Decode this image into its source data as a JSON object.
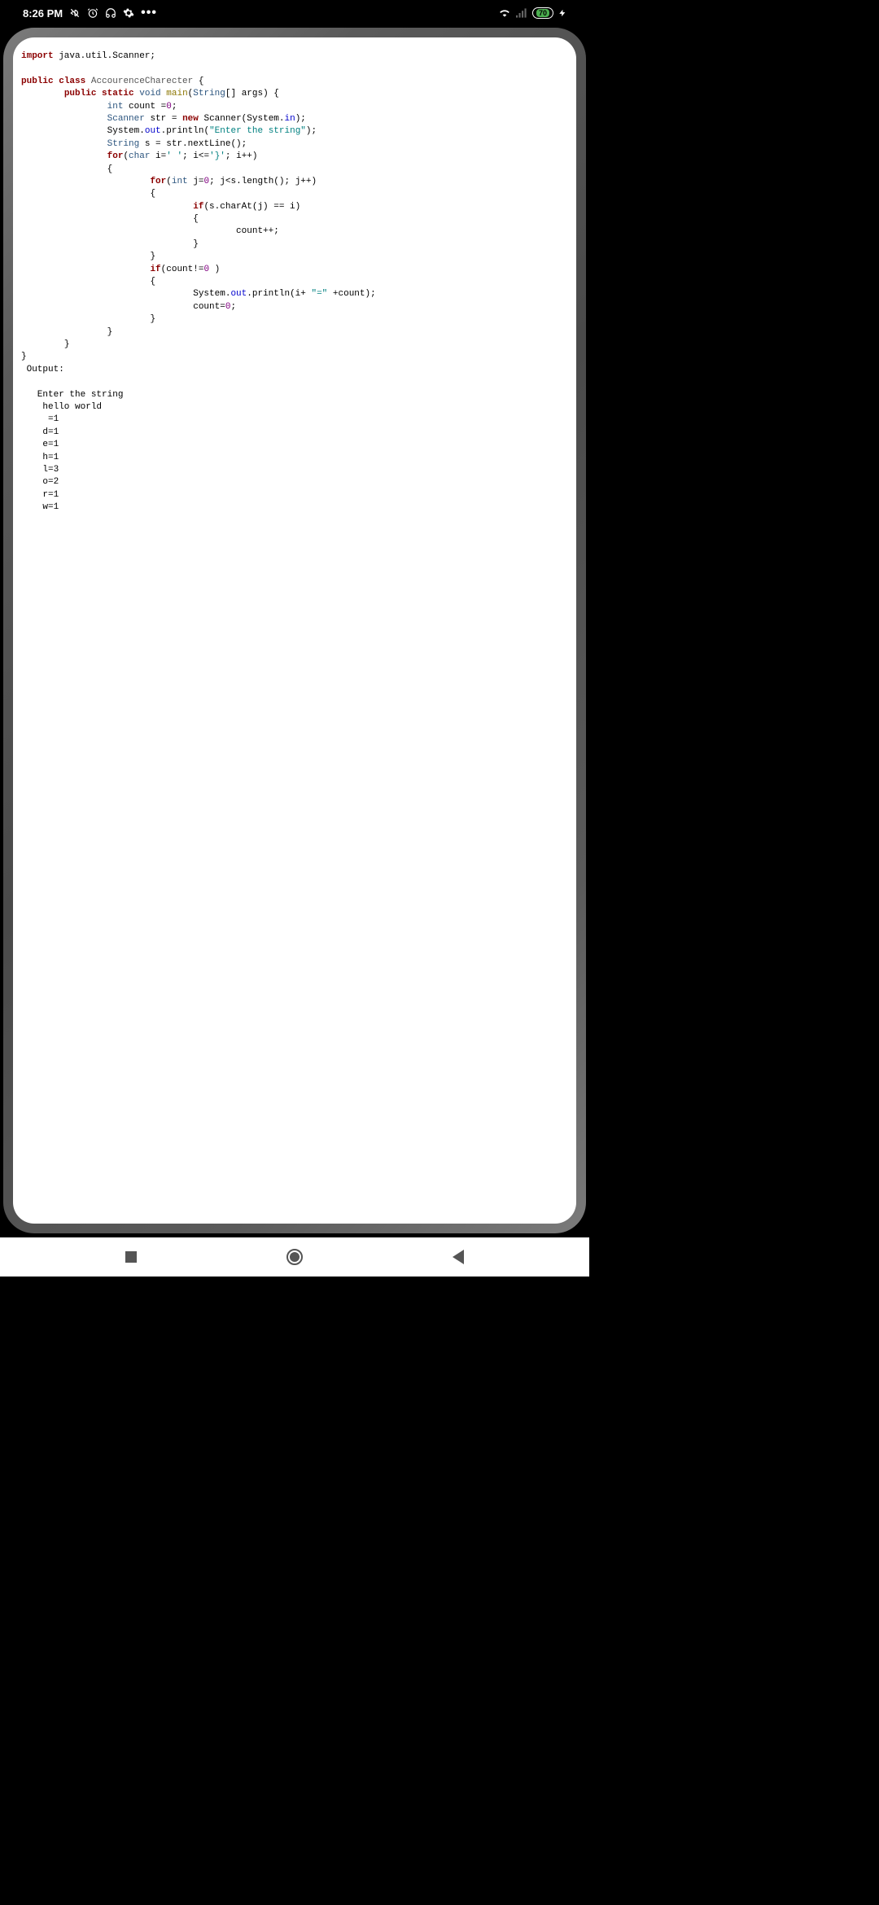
{
  "status": {
    "time": "8:26 PM",
    "battery": "70"
  },
  "code": {
    "line1_kw1": "import",
    "line1_rest": " java.util.Scanner;",
    "line3_kw1": "public",
    "line3_kw2": "class",
    "line3_cls": "AccourenceCharecter",
    "line3_brace": " {",
    "line4_indent": "        ",
    "line4_kw1": "public",
    "line4_kw2": "static",
    "line4_type": "void",
    "line4_method": "main",
    "line4_paren": "(",
    "line4_argtype": "String",
    "line4_args": "[] args) {",
    "line5_indent": "                ",
    "line5_type": "int",
    "line5_rest": " count =",
    "line5_num": "0",
    "line5_semi": ";",
    "line6_indent": "                ",
    "line6_type": "Scanner",
    "line6_var": " str = ",
    "line6_kw": "new",
    "line6_rest": " Scanner(System.",
    "line6_field": "in",
    "line6_end": ");",
    "line7_indent": "                ",
    "line7_sys": "System.",
    "line7_out": "out",
    "line7_print": ".println(",
    "line7_str": "\"Enter the string\"",
    "line7_end": ");",
    "line8_indent": "                ",
    "line8_type": "String",
    "line8_rest": " s = str.nextLine();",
    "line9_indent": "                ",
    "line9_kw": "for",
    "line9_paren": "(",
    "line9_type": "char",
    "line9_rest": " i=",
    "line9_char1": "' '",
    "line9_mid": "; i<=",
    "line9_char2": "'}'",
    "line9_end": "; i++)",
    "line10_indent": "                ",
    "line10_brace": "{",
    "line11_indent": "                        ",
    "line11_kw": "for",
    "line11_paren": "(",
    "line11_type": "int",
    "line11_rest": " j=",
    "line11_num1": "0",
    "line11_mid": "; j<s.length(); j++)",
    "line12_indent": "                        ",
    "line12_brace": "{",
    "line13_indent": "                                ",
    "line13_kw": "if",
    "line13_rest": "(s.charAt(j) == i)",
    "line14_indent": "                                ",
    "line14_brace": "{",
    "line15_indent": "                                        ",
    "line15_rest": "count++;",
    "line16_indent": "                                ",
    "line16_brace": "}",
    "line17_indent": "                        ",
    "line17_brace": "}",
    "line18_indent": "                        ",
    "line18_kw": "if",
    "line18_rest": "(count!=",
    "line18_num": "0",
    "line18_end": " )",
    "line19_indent": "                        ",
    "line19_brace": "{",
    "line20_indent": "                                ",
    "line20_sys": "System.",
    "line20_out": "out",
    "line20_print": ".println(i+ ",
    "line20_str": "\"=\"",
    "line20_end": " +count);",
    "line21_indent": "                                ",
    "line21_rest": "count=",
    "line21_num": "0",
    "line21_semi": ";",
    "line22_indent": "                        ",
    "line22_brace": "}",
    "line23_indent": "                ",
    "line23_brace": "}",
    "line24_indent": "        ",
    "line24_brace": "}",
    "line25_brace": "}",
    "output_label": " Output:",
    "out1": "   Enter the string",
    "out2": "    hello world",
    "out3": "     =1",
    "out4": "    d=1",
    "out5": "    e=1",
    "out6": "    h=1",
    "out7": "    l=3",
    "out8": "    o=2",
    "out9": "    r=1",
    "out10": "    w=1"
  }
}
